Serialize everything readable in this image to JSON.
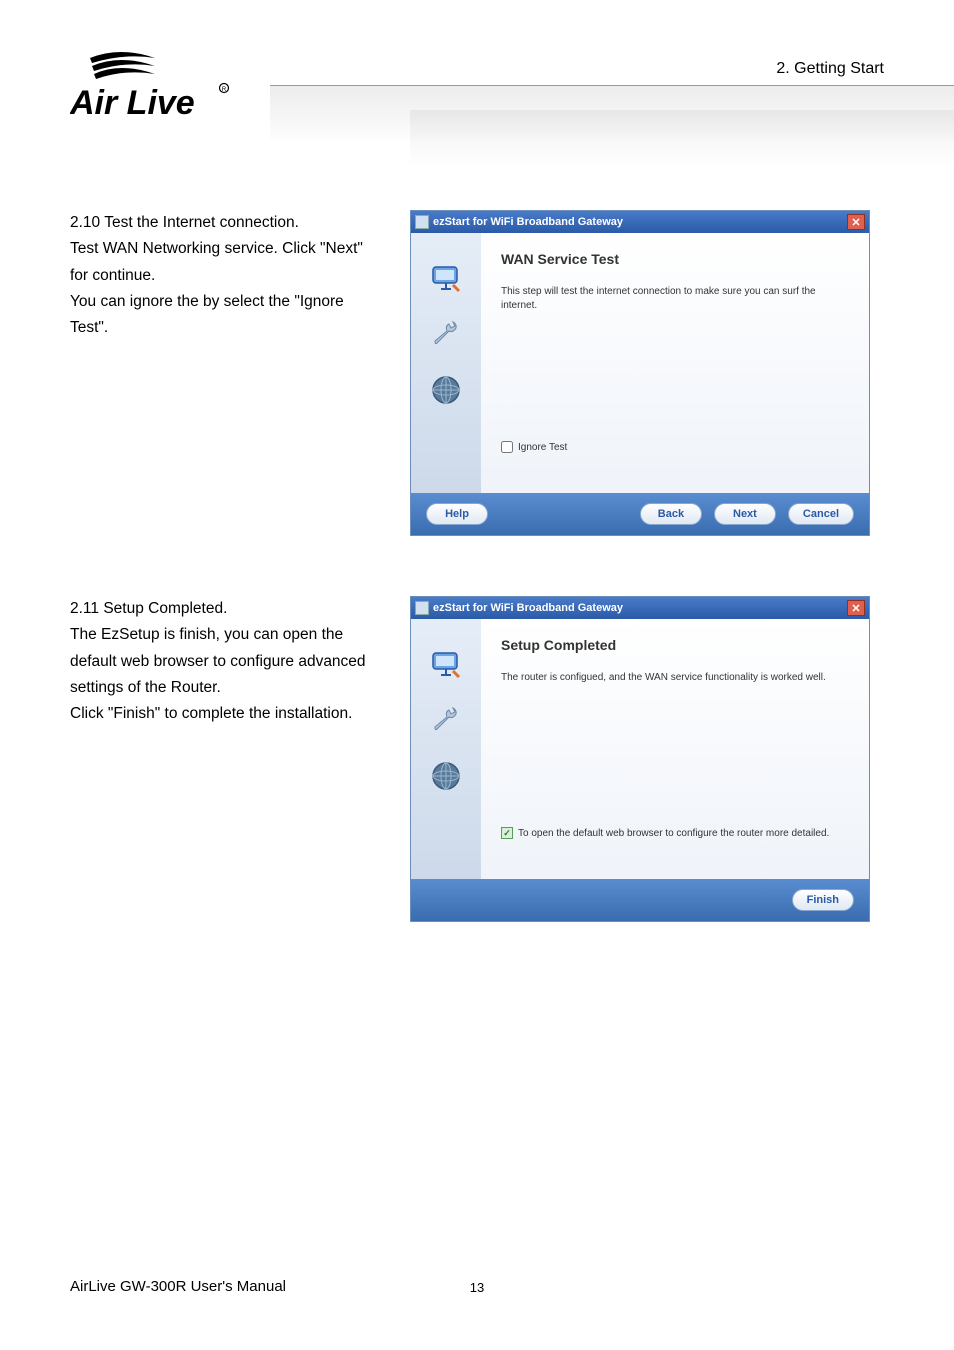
{
  "header": {
    "section_label": "2.  Getting  Start",
    "logo_alt": "Air Live"
  },
  "section_a": {
    "heading": "2.10 Test the Internet connection.",
    "line1": "Test WAN Networking service. Click \"Next\" for continue.",
    "line2": "You can ignore the by select the \"Ignore Test\"."
  },
  "wizard_a": {
    "title": "ezStart for WiFi Broadband Gateway",
    "heading": "WAN Service Test",
    "desc": "This step will test the internet connection to make sure you can surf the internet.",
    "checkbox_label": "Ignore Test",
    "checkbox_checked": false,
    "buttons": {
      "help": "Help",
      "back": "Back",
      "next": "Next",
      "cancel": "Cancel"
    }
  },
  "section_b": {
    "heading": "2.11 Setup Completed.",
    "body": "The EzSetup is finish, you can open the default web browser to configure advanced settings of the Router.",
    "body2": "Click \"Finish\" to complete the installation."
  },
  "wizard_b": {
    "title": "ezStart for WiFi Broadband Gateway",
    "heading": "Setup Completed",
    "desc": "The router is configued, and the WAN service functionality is worked well.",
    "checkbox_label": "To open the default web browser to configure the router more detailed.",
    "checkbox_checked": true,
    "buttons": {
      "finish": "Finish"
    }
  },
  "footer": {
    "product": "AirLive GW-300R User's Manual",
    "page": "13"
  },
  "icons": {
    "monitor": "monitor-icon",
    "wrench": "wrench-icon",
    "globe": "globe-icon"
  }
}
